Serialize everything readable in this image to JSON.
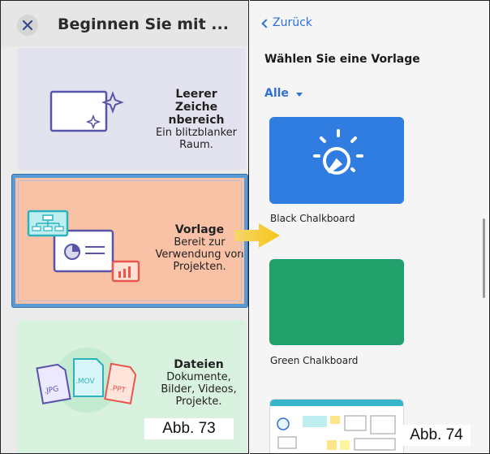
{
  "left_screen": {
    "title": "Beginnen Sie mit ...",
    "cards": [
      {
        "title": "Leerer Zeiche nbereich",
        "description": "Ein blitzblanker Raum."
      },
      {
        "title": "Vorlage",
        "description": "Bereit zur Verwendung von Projekten."
      },
      {
        "title": "Dateien",
        "description": "Dokumente, Bilder, Videos, Projekte."
      }
    ],
    "file_labels": [
      ".JPG",
      ".MOV",
      ".PPT"
    ],
    "caption": "Abb. 73"
  },
  "right_screen": {
    "back_label": "Zurück",
    "heading": "Wählen Sie eine Vorlage",
    "filter_label": "Alle",
    "templates": [
      {
        "name": "Black Chalkboard"
      },
      {
        "name": "Green Chalkboard"
      }
    ],
    "caption": "Abb. 74"
  },
  "colors": {
    "accent_blue": "#2f6fd6",
    "template_card": "#f9c2a7",
    "selection_border": "#5b9bd5",
    "blank_card": "#e3e3ef",
    "files_card": "#d9f2e0",
    "black_chalkboard_thumb": "#2f7de1",
    "green_chalkboard_thumb": "#22a06b",
    "arrow": "#f5c518"
  },
  "icons": {
    "close": "close-icon",
    "back": "chevron-left-icon",
    "filter": "caret-down-icon",
    "arrow": "arrow-right-icon"
  }
}
